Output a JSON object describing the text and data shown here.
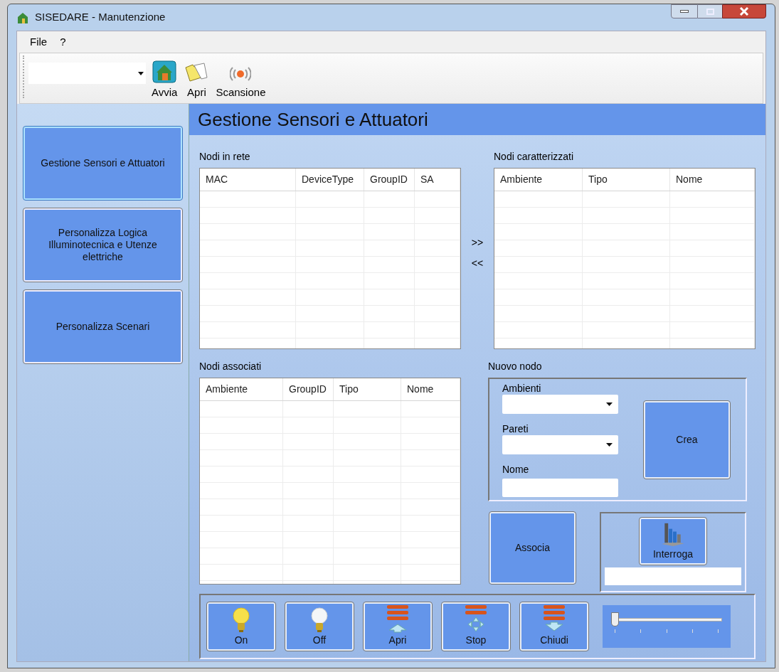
{
  "window": {
    "title": "SISEDARE - Manutenzione"
  },
  "menu": [
    {
      "label": "File"
    },
    {
      "label": "?"
    }
  ],
  "toolbar": {
    "buttons": [
      {
        "kind": "start",
        "label": "Avvia"
      },
      {
        "kind": "open",
        "label": "Apri"
      },
      {
        "kind": "scan",
        "label": "Scansione"
      }
    ]
  },
  "sidebar": {
    "items": [
      {
        "label": "Gestione Sensori e Attuatori",
        "selected": true
      },
      {
        "label": "Personalizza Logica Illuminotecnica e Utenze elettriche",
        "selected": false
      },
      {
        "label": "Personalizza Scenari",
        "selected": false
      }
    ]
  },
  "header": {
    "title": "Gestione Sensori e Attuatori"
  },
  "nodi_in_rete": {
    "label": "Nodi in rete",
    "columns": [
      "MAC",
      "DeviceType",
      "GroupID",
      "SA"
    ]
  },
  "transfer": [
    ">>",
    "<<"
  ],
  "nodi_caratterizzati": {
    "label": "Nodi caratterizzati",
    "columns": [
      "Ambiente",
      "Tipo",
      "Nome"
    ]
  },
  "nodi_associati": {
    "label": "Nodi associati",
    "columns": [
      "Ambiente",
      "GroupID",
      "Tipo",
      "Nome"
    ]
  },
  "nuovo_nodo": {
    "label": "Nuovo nodo",
    "fields": [
      {
        "kind": "dropdown",
        "label": "Ambienti"
      },
      {
        "kind": "dropdown",
        "label": "Pareti"
      },
      {
        "kind": "text",
        "label": "Nome"
      }
    ],
    "create_button": "Crea"
  },
  "associa_button": "Associa",
  "interroga_button": "Interroga",
  "controls": [
    {
      "kind": "bulb-on",
      "label": "On"
    },
    {
      "kind": "bulb-off",
      "label": "Off"
    },
    {
      "kind": "up",
      "label": "Apri"
    },
    {
      "kind": "stop",
      "label": "Stop"
    },
    {
      "kind": "down",
      "label": "Chiudi"
    }
  ],
  "slider": {
    "level": 0
  }
}
